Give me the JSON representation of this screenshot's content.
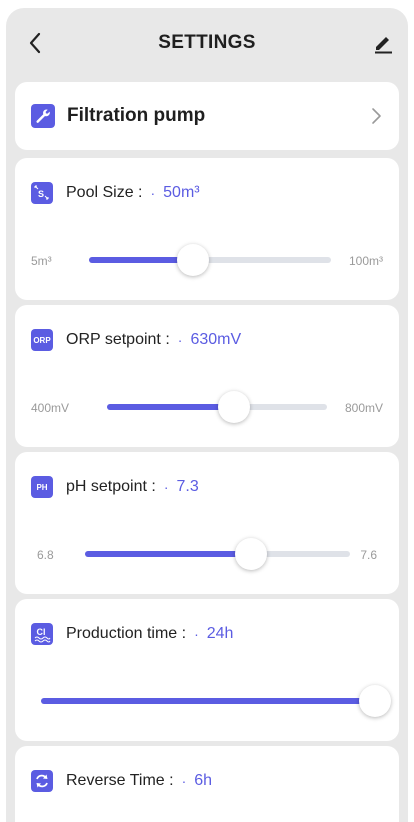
{
  "header": {
    "title": "SETTINGS"
  },
  "pump": {
    "label": "Filtration pump"
  },
  "settings": [
    {
      "icon": "pool-size-icon",
      "badge": "",
      "label": "Pool Size :",
      "dot": "·",
      "value": "50m³",
      "min": "5m³",
      "max": "100m³",
      "fraction": 0.43
    },
    {
      "icon": "orp-icon",
      "badge": "ORP",
      "label": "ORP setpoint :",
      "dot": "·",
      "value": "630mV",
      "min": "400mV",
      "max": "800mV",
      "fraction": 0.575
    },
    {
      "icon": "ph-icon",
      "badge": "PH",
      "label": "pH setpoint :",
      "dot": "·",
      "value": "7.3",
      "min": "6.8",
      "max": "7.6",
      "fraction": 0.625
    },
    {
      "icon": "cl-icon",
      "badge": "",
      "label": "Production time :",
      "dot": "·",
      "value": "24h",
      "min": "",
      "max": "",
      "fraction": 1.0
    },
    {
      "icon": "reverse-icon",
      "badge": "",
      "label": "Reverse Time :",
      "dot": "·",
      "value": "6h",
      "min": "",
      "max": "",
      "fraction": null
    }
  ],
  "colors": {
    "accent": "#5b5ce2",
    "track": "#dfe2e8",
    "background": "#e8e8e8"
  }
}
